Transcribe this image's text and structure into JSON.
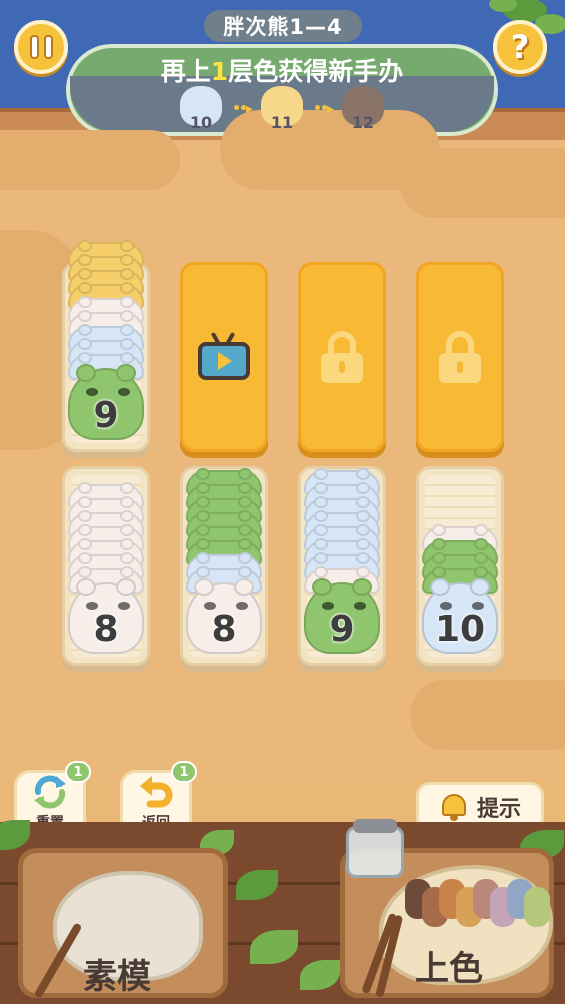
{
  "header": {
    "level_title": "胖次熊1—4",
    "goal_prefix": "再上",
    "goal_number": "1",
    "goal_suffix": "层色获得新手办",
    "goal_steps": [
      {
        "value": "10",
        "color": "#d7e6f7"
      },
      {
        "value": "11",
        "color": "#f7d88a"
      },
      {
        "value": "12",
        "color": "#8a7468"
      }
    ],
    "pause_icon": "pause-icon",
    "help_icon": "question-icon",
    "help_label": "?"
  },
  "columns": [
    {
      "top": {
        "type": "stack",
        "bear_color": "#8fc56d",
        "count_label": "9",
        "chips": [
          "#f7cf6a",
          "#f7cf6a",
          "#f7cf6a",
          "#f7cf6a",
          "#f7eeea",
          "#f7eeea",
          "#d7e6f7",
          "#d7e6f7",
          "#d7e6f7"
        ]
      },
      "bottom": {
        "type": "stack",
        "bear_color": "#f7eeea",
        "count_label": "8",
        "chips": [
          "#f7eeea",
          "#f7eeea",
          "#f7eeea",
          "#f7eeea",
          "#f7eeea",
          "#f7eeea",
          "#f7eeea"
        ]
      }
    },
    {
      "top": {
        "type": "ad",
        "icon": "tv-play-icon"
      },
      "bottom": {
        "type": "stack",
        "bear_color": "#f7eeea",
        "count_label": "8",
        "chips": [
          "#8fc56d",
          "#8fc56d",
          "#8fc56d",
          "#8fc56d",
          "#8fc56d",
          "#8fc56d",
          "#d7e6f7",
          "#d7e6f7"
        ]
      }
    },
    {
      "top": {
        "type": "locked",
        "icon": "lock-icon"
      },
      "bottom": {
        "type": "stack",
        "bear_color": "#8fc56d",
        "count_label": "9",
        "chips": [
          "#d7e6f7",
          "#d7e6f7",
          "#d7e6f7",
          "#d7e6f7",
          "#d7e6f7",
          "#d7e6f7",
          "#d7e6f7",
          "#f7eeea"
        ]
      }
    },
    {
      "top": {
        "type": "locked",
        "icon": "lock-icon"
      },
      "bottom": {
        "type": "stack",
        "bear_color": "#d7e6f7",
        "count_label": "10",
        "chips": [
          "#f7eeea",
          "#8fc56d",
          "#8fc56d",
          "#8fc56d"
        ]
      }
    }
  ],
  "tools": {
    "reset": {
      "label": "重置",
      "badge": "1",
      "icon": "refresh-icon"
    },
    "undo": {
      "label": "返回",
      "badge": "1",
      "icon": "undo-icon"
    },
    "hint": {
      "label": "提示",
      "icon": "bell-icon"
    }
  },
  "bottom_cards": {
    "sculpt": {
      "label": "素模",
      "icon": "stone-icon"
    },
    "paint": {
      "label": "上色",
      "icon": "palette-icon",
      "paints": [
        "#6d4a3a",
        "#a56b4a",
        "#c9824a",
        "#d7a257",
        "#b9887a",
        "#c6a4b8",
        "#8fa6c7",
        "#b4c77a"
      ]
    }
  }
}
